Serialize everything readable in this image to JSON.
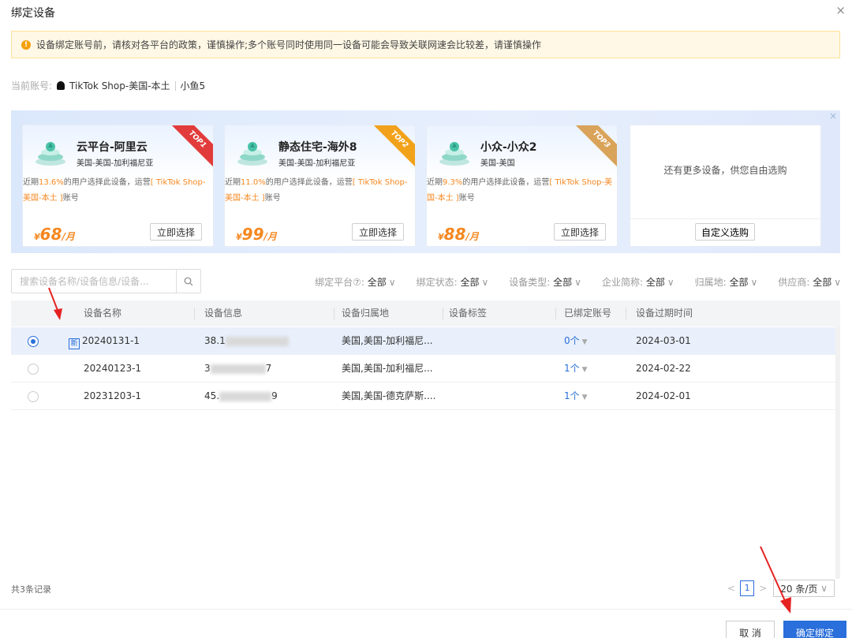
{
  "modal": {
    "title": "绑定设备",
    "close": "×"
  },
  "alert": {
    "icon": "warning-icon",
    "text": "设备绑定账号前，请核对各平台的政策，谨慎操作;多个账号同时使用同一设备可能会导致关联网速会比较差，请谨慎操作"
  },
  "account": {
    "label": "当前账号:",
    "platform": "TikTok Shop-美国-本土",
    "name": "小鱼5"
  },
  "promo": {
    "close": "×",
    "cards": [
      {
        "title": "云平台-阿里云",
        "region": "美国-美国-加利福尼亚",
        "desc_pre": "近期",
        "pct": "13.6%",
        "desc_mid": "的用户选择此设备，运营",
        "shop": "[ TikTok Shop-美国-本土 ]",
        "desc_post": "账号",
        "currency": "¥",
        "price": "68",
        "unit": "/月",
        "button": "立即选择",
        "badge": "TOP1",
        "badge_color": "#e23b3b"
      },
      {
        "title": "静态住宅-海外8",
        "region": "美国-美国-加利福尼亚",
        "desc_pre": "近期",
        "pct": "11.0%",
        "desc_mid": "的用户选择此设备，运营",
        "shop": "[ TikTok Shop-美国-本土 ]",
        "desc_post": "账号",
        "currency": "¥",
        "price": "99",
        "unit": "/月",
        "button": "立即选择",
        "badge": "TOP2",
        "badge_color": "#f2a21a"
      },
      {
        "title": "小众-小众2",
        "region": "美国-美国",
        "desc_pre": "近期",
        "pct": "9.3%",
        "desc_mid": "的用户选择此设备，运营",
        "shop": "[ TikTok Shop-美国-本土 ]",
        "desc_post": "账号",
        "currency": "¥",
        "price": "88",
        "unit": "/月",
        "button": "立即选择",
        "badge": "TOP3",
        "badge_color": "#d9a35a"
      }
    ],
    "more": {
      "text": "还有更多设备，供您自由选购",
      "button": "自定义选购"
    }
  },
  "search": {
    "placeholder": "搜索设备名称/设备信息/设备..."
  },
  "filters": [
    {
      "label": "绑定平台⑦:",
      "value": "全部"
    },
    {
      "label": "绑定状态:",
      "value": "全部"
    },
    {
      "label": "设备类型:",
      "value": "全部"
    },
    {
      "label": "企业简称:",
      "value": "全部"
    },
    {
      "label": "归属地:",
      "value": "全部"
    },
    {
      "label": "供应商:",
      "value": "全部"
    }
  ],
  "table": {
    "headers": [
      "设备名称",
      "设备信息",
      "设备归属地",
      "设备标签",
      "已绑定账号",
      "设备过期时间"
    ],
    "rows": [
      {
        "selected": true,
        "is_new": true,
        "new_label": "新",
        "name": "20240131-1",
        "info": "38.1",
        "info_tail": "",
        "location": "美国,美国-加利福尼...",
        "tag": "",
        "bound": "0个",
        "expire": "2024-03-01"
      },
      {
        "selected": false,
        "is_new": false,
        "new_label": "",
        "name": "20240123-1",
        "info": "3",
        "info_tail": "7",
        "location": "美国,美国-加利福尼...",
        "tag": "",
        "bound": "1个",
        "expire": "2024-02-22"
      },
      {
        "selected": false,
        "is_new": false,
        "new_label": "",
        "name": "20231203-1",
        "info": "45.",
        "info_tail": "9",
        "location": "美国,美国-德克萨斯....",
        "tag": "",
        "bound": "1个",
        "expire": "2024-02-01"
      }
    ]
  },
  "pagination": {
    "total": "共3条记录",
    "prev": "<",
    "page": "1",
    "next": ">",
    "page_size": "20 条/页",
    "chevron": "∨"
  },
  "footer": {
    "cancel": "取 消",
    "confirm": "确定绑定"
  },
  "colors": {
    "primary": "#2a6fdb",
    "highlight": "#f5871f",
    "arrow": "#e52222"
  }
}
